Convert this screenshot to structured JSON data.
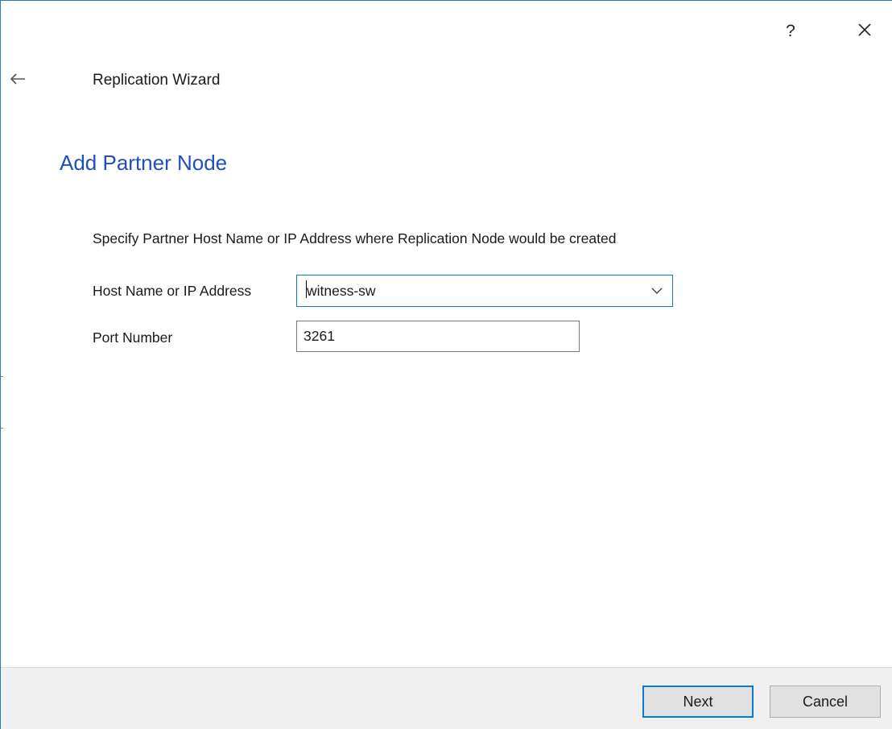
{
  "titlebar": {
    "help_label": "?",
    "close_icon": "close-icon"
  },
  "header": {
    "back_icon": "back-arrow-icon",
    "wizard_title": "Replication Wizard"
  },
  "page": {
    "heading": "Add Partner Node",
    "instruction": "Specify Partner Host Name or IP Address where Replication Node would be created"
  },
  "form": {
    "host": {
      "label": "Host Name or IP Address",
      "value": "witness-sw",
      "dropdown_icon": "chevron-down-icon"
    },
    "port": {
      "label": "Port Number",
      "value": "3261"
    }
  },
  "footer": {
    "next_label": "Next",
    "cancel_label": "Cancel"
  },
  "colors": {
    "accent": "#0a78d7",
    "heading": "#1f4ec0",
    "window_border": "#2b78c5",
    "footer_bg": "#f0f0f0"
  }
}
